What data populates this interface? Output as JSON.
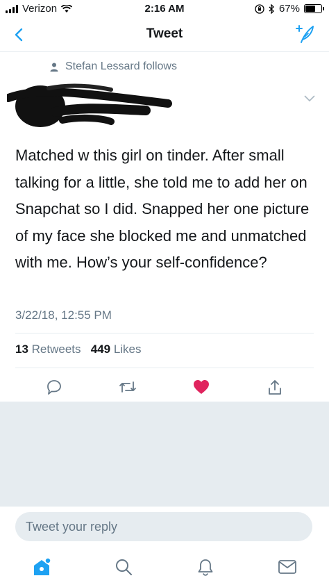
{
  "status_bar": {
    "carrier": "Verizon",
    "time": "2:16 AM",
    "battery": "67%",
    "battery_level": 0.67
  },
  "nav": {
    "title": "Tweet"
  },
  "tweet": {
    "social_context": "Stefan Lessard follows",
    "text": "Matched w this girl on tinder. After small talking for a little, she told me to add her on Snapchat so I did. Snapped her one picture of my face she blocked me and unmatched with me. How’s your self-confidence?",
    "timestamp": "3/22/18, 12:55 PM",
    "retweets_count": "13",
    "retweets_label": "Retweets",
    "likes_count": "449",
    "likes_label": "Likes",
    "liked": true
  },
  "reply": {
    "placeholder": "Tweet your reply"
  },
  "colors": {
    "accent": "#1da1f2",
    "like": "#e0245e",
    "secondary_text": "#657786",
    "divider": "#e6ecf0"
  },
  "icons": {
    "back": "chevron-left-icon",
    "compose": "compose-feather-icon",
    "reply": "reply-bubble-icon",
    "retweet": "retweet-icon",
    "like": "heart-icon",
    "share": "share-icon",
    "home": "home-icon",
    "search": "search-icon",
    "notifications": "bell-icon",
    "messages": "envelope-icon"
  }
}
